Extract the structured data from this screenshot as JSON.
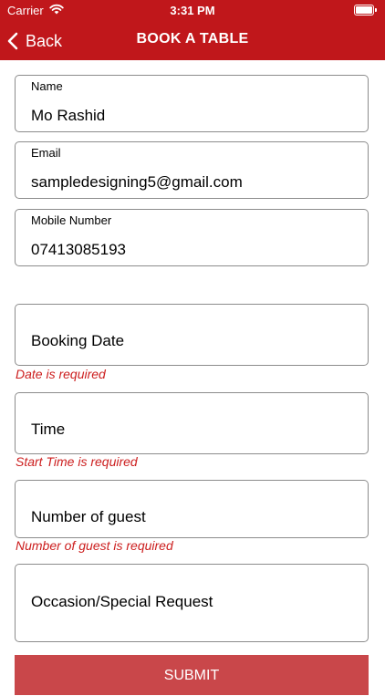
{
  "status_bar": {
    "carrier": "Carrier",
    "time": "3:31 PM"
  },
  "nav": {
    "back_label": "Back",
    "title": "BOOK A TABLE"
  },
  "form": {
    "name": {
      "label": "Name",
      "value": "Mo Rashid"
    },
    "email": {
      "label": "Email",
      "value": "sampledesigning5@gmail.com"
    },
    "mobile": {
      "label": "Mobile Number",
      "value": "07413085193"
    },
    "booking_date": {
      "placeholder": "Booking Date",
      "error": "Date is required"
    },
    "time": {
      "placeholder": "Time",
      "error": "Start Time is required"
    },
    "guests": {
      "placeholder": "Number of guest",
      "error": "Number of guest is required"
    },
    "occasion": {
      "placeholder": "Occasion/Special Request"
    }
  },
  "submit_label": "SUBMIT",
  "colors": {
    "brand": "#c0171b",
    "error": "#cc1e1e",
    "submit": "#c9474a"
  }
}
